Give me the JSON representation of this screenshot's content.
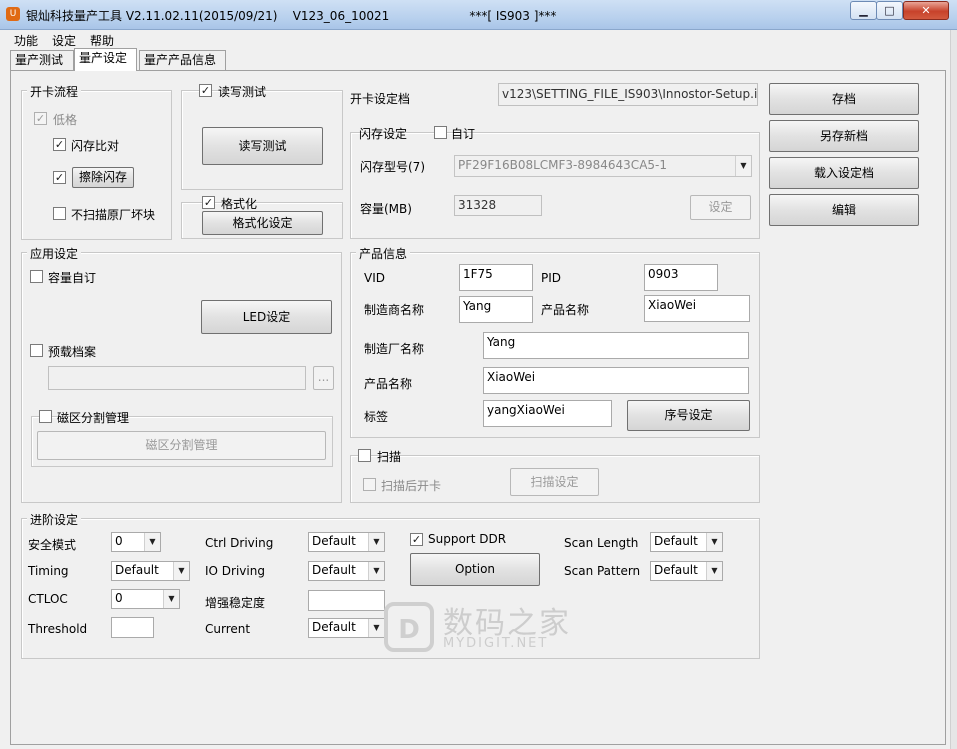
{
  "window": {
    "title": "银灿科技量产工具 V2.11.02.11(2015/09/21)    V123_06_10021                     ***[ IS903 ]***",
    "app_icon_glyph": "U",
    "min_glyph": "▁",
    "max_glyph": "□",
    "close_glyph": "✕"
  },
  "menu": [
    "功能",
    "设定",
    "帮助"
  ],
  "tabs": [
    "量产测试",
    "量产设定",
    "量产产品信息"
  ],
  "active_tab": 1,
  "card_flow": {
    "title": "开卡流程",
    "low_format": {
      "label": "低格",
      "checked": true,
      "disabled": true
    },
    "flash_compare": {
      "label": "闪存比对",
      "checked": true
    },
    "erase_flash": {
      "label": "擦除闪存",
      "checked": true
    },
    "no_scan_bad": {
      "label": "不扫描原厂坏块",
      "checked": false
    }
  },
  "rw_test": {
    "label": "读写测试",
    "checked": true,
    "button": "读写测试"
  },
  "format": {
    "label": "格式化",
    "checked": true,
    "button": "格式化设定"
  },
  "setting_file": {
    "label": "开卡设定档",
    "value": "v123\\SETTING_FILE_IS903\\Innostor-Setup.ini"
  },
  "file_buttons": [
    "存档",
    "另存新档",
    "载入设定档",
    "编辑"
  ],
  "flash_settings": {
    "title": "闪存设定",
    "custom_label": "自订",
    "custom_checked": false,
    "model_label": "闪存型号(7)",
    "model_value": "PF29F16B08LCMF3-8984643CA5-1",
    "capacity_label": "容量(MB)",
    "capacity_value": "31328",
    "set_button": "设定"
  },
  "app_settings": {
    "title": "应用设定",
    "capacity_custom": "容量自订",
    "led_button": "LED设定",
    "preload": "预载档案",
    "preload_path": "",
    "browse": "...",
    "partition_label": "磁区分割管理",
    "partition_button": "磁区分割管理"
  },
  "product_info": {
    "title": "产品信息",
    "vid_label": "VID",
    "vid": "1F75",
    "pid_label": "PID",
    "pid": "0903",
    "vendor_label": "制造商名称",
    "vendor": "Yang",
    "product_label": "产品名称",
    "product": "XiaoWei",
    "manufacturer_label": "制造厂名称",
    "manufacturer": "Yang",
    "product_name_label": "产品名称",
    "product_name": "XiaoWei",
    "tag_label": "标签",
    "tag": "yangXiaoWei",
    "serial_button": "序号设定"
  },
  "scan": {
    "label": "扫描",
    "after_label": "扫描后开卡",
    "button": "扫描设定"
  },
  "advanced": {
    "title": "进阶设定",
    "security_label": "安全模式",
    "security": "0",
    "timing_label": "Timing",
    "timing": "Default",
    "ctloc_label": "CTLOC",
    "ctloc": "0",
    "threshold_label": "Threshold",
    "threshold": "",
    "ctrl_driving_label": "Ctrl Driving",
    "ctrl_driving": "Default",
    "io_driving_label": "IO Driving",
    "io_driving": "Default",
    "stability_label": "增强稳定度",
    "stability": "",
    "current_label": "Current",
    "current": "Default",
    "ddr_label": "Support DDR",
    "ddr_checked": true,
    "option_button": "Option",
    "scan_length_label": "Scan Length",
    "scan_length": "Default",
    "scan_pattern_label": "Scan Pattern",
    "scan_pattern": "Default"
  },
  "watermark": {
    "cn": "数码之家",
    "en": "MYDIGIT.NET"
  },
  "glyphs": {
    "check": "✓",
    "dropdown": "▼"
  }
}
